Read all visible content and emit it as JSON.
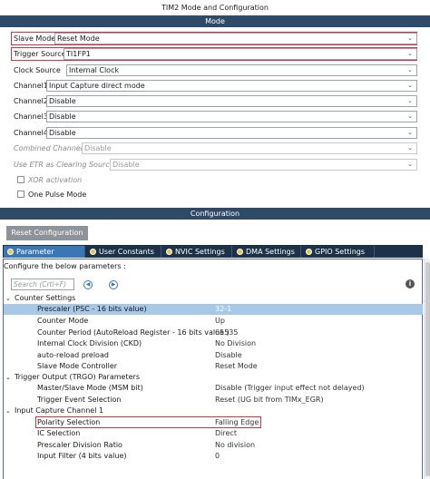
{
  "window_title": "TIM2 Mode and Configuration",
  "mode_header": "Mode",
  "mode_rows": [
    {
      "label": "Slave Mode",
      "value": "Reset Mode"
    },
    {
      "label": "Trigger Source",
      "value": "TI1FP1"
    },
    {
      "label": "Clock Source",
      "value": "Internal Clock"
    },
    {
      "label": "Channel1",
      "value": "Input Capture direct mode"
    },
    {
      "label": "Channel2",
      "value": "Disable"
    },
    {
      "label": "Channel3",
      "value": "Disable"
    },
    {
      "label": "Channel4",
      "value": "Disable"
    },
    {
      "label": "Combined Channels",
      "value": "Disable"
    },
    {
      "label": "Use ETR as Clearing Source",
      "value": "Disable"
    }
  ],
  "checkboxes": {
    "xor": "XOR activation",
    "one_pulse": "One Pulse Mode"
  },
  "config_header": "Configuration",
  "reset_button": "Reset Configuration",
  "tabs": [
    "Parameter Settings",
    "User Constants",
    "NVIC Settings",
    "DMA Settings",
    "GPIO Settings"
  ],
  "config_hint": "Configure the below parameters :",
  "search_placeholder": "Search (Crtl+F)",
  "groups": {
    "counter": "Counter Settings",
    "trgo": "Trigger Output (TRGO) Parameters",
    "ic1": "Input Capture Channel 1"
  },
  "params": {
    "prescaler": {
      "name": "Prescaler (PSC - 16 bits value)",
      "value": "32-1"
    },
    "counter_mode": {
      "name": "Counter Mode",
      "value": "Up"
    },
    "counter_period": {
      "name": "Counter Period (AutoReload Register - 16 bits value )",
      "value": "65535"
    },
    "ckd": {
      "name": "Internal Clock Division (CKD)",
      "value": "No Division"
    },
    "arpe": {
      "name": "auto-reload preload",
      "value": "Disable"
    },
    "slave_ctrl": {
      "name": "Slave Mode Controller",
      "value": "Reset Mode"
    },
    "msm": {
      "name": "Master/Slave Mode (MSM bit)",
      "value": "Disable (Trigger input effect not delayed)"
    },
    "trgo_sel": {
      "name": "Trigger Event Selection",
      "value": "Reset (UG bit from TIMx_EGR)"
    },
    "polarity": {
      "name": "Polarity Selection",
      "value": "Falling Edge"
    },
    "ic_sel": {
      "name": "IC Selection",
      "value": "Direct"
    },
    "ic_psc": {
      "name": "Prescaler Division Ratio",
      "value": "No division"
    },
    "ic_filter": {
      "name": "Input Filter (4 bits value)",
      "value": "0"
    }
  },
  "icons": {
    "dropdown": "chevron-down-icon",
    "expand": "triangle-down-icon",
    "info": "info-icon",
    "tab_status": "green-dot-icon"
  },
  "colors": {
    "header_band": "#2e4a66",
    "tab_active": "#3b77b5",
    "highlight_row": "#a7c8e6",
    "red_outline": "#d9303b"
  }
}
